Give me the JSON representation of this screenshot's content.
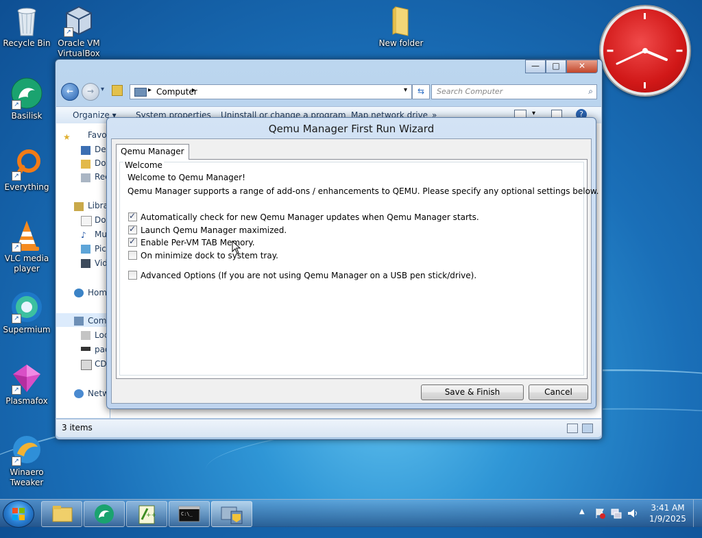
{
  "desktop": {
    "icons": [
      {
        "label": "Recycle Bin"
      },
      {
        "label": "Oracle VM VirtualBox"
      },
      {
        "label": "New folder"
      },
      {
        "label": "Basilisk"
      },
      {
        "label": "Everything"
      },
      {
        "label": "VLC media player"
      },
      {
        "label": "Supermium"
      },
      {
        "label": "Plasmafox"
      },
      {
        "label": "Winaero Tweaker"
      }
    ]
  },
  "explorer": {
    "address": "Computer",
    "search_placeholder": "Search Computer",
    "commands": [
      "Organize ▾",
      "System properties",
      "Uninstall or change a program",
      "Map network drive",
      "»"
    ],
    "nav_items": [
      "Favo",
      "Des",
      "Dow",
      "Rec",
      "Libra",
      "Doc",
      "Mus",
      "Pict",
      "Vide",
      "Home",
      "Comp",
      "Loca",
      "pad",
      "CD D",
      "Netw"
    ],
    "status": "3 items"
  },
  "wizard": {
    "title": "Qemu Manager First Run Wizard",
    "tab_label": "Qemu Manager",
    "group_label": "Welcome",
    "welcome": "Welcome to Qemu Manager!",
    "intro": "Qemu Manager supports a range of add-ons / enhancements to QEMU.  Please specify any optional settings below.",
    "options": [
      {
        "label": "Automatically check for new Qemu Manager updates when Qemu Manager starts.",
        "checked": true
      },
      {
        "label": "Launch Qemu Manager maximized.",
        "checked": true
      },
      {
        "label": "Enable Per-VM TAB Memory.",
        "checked": true
      },
      {
        "label": "On minimize dock to system tray.",
        "checked": false
      },
      {
        "label": "Advanced Options (If you are not using Qemu Manager on a USB pen stick/drive).",
        "checked": false
      }
    ],
    "save_label": "Save & Finish",
    "cancel_label": "Cancel"
  },
  "taskbar": {
    "time": "3:41 AM",
    "date": "1/9/2025"
  },
  "colors": {
    "clock_face": "#d11818",
    "desktop_blue": "#1a6fb8"
  }
}
